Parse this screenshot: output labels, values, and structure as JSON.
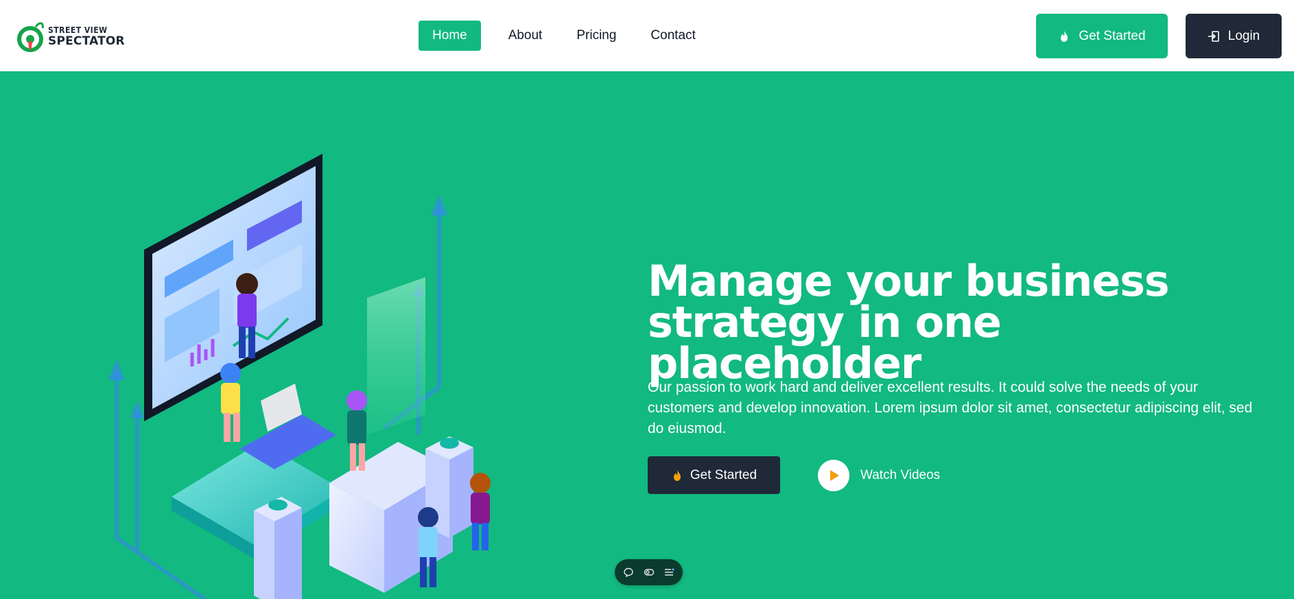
{
  "brand": {
    "logo_line1": "STREET VIEW",
    "logo_line2": "SPECTATOR",
    "accent": "#12b981",
    "dark": "#1f2937"
  },
  "nav": {
    "items": [
      {
        "label": "Home",
        "active": true
      },
      {
        "label": "About"
      },
      {
        "label": "Pricing"
      },
      {
        "label": "Contact"
      }
    ]
  },
  "header_actions": {
    "get_started": "Get Started",
    "login": "Login"
  },
  "hero": {
    "title_line1": "Manage your business",
    "title_line2": "strategy in one placeholder",
    "text": "Our passion to work hard and deliver excellent results. It could solve the needs of your customers and develop innovation. Lorem ipsum dolor sit amet, consectetur adipiscing elit, sed do eiusmod.",
    "cta": "Get Started",
    "watch": "Watch Videos"
  },
  "icons": {
    "flame": "flame-icon",
    "login": "login-icon",
    "play": "play-icon",
    "chat": "chat-icon",
    "toggle": "toggle-icon",
    "menu": "menu-icon"
  }
}
